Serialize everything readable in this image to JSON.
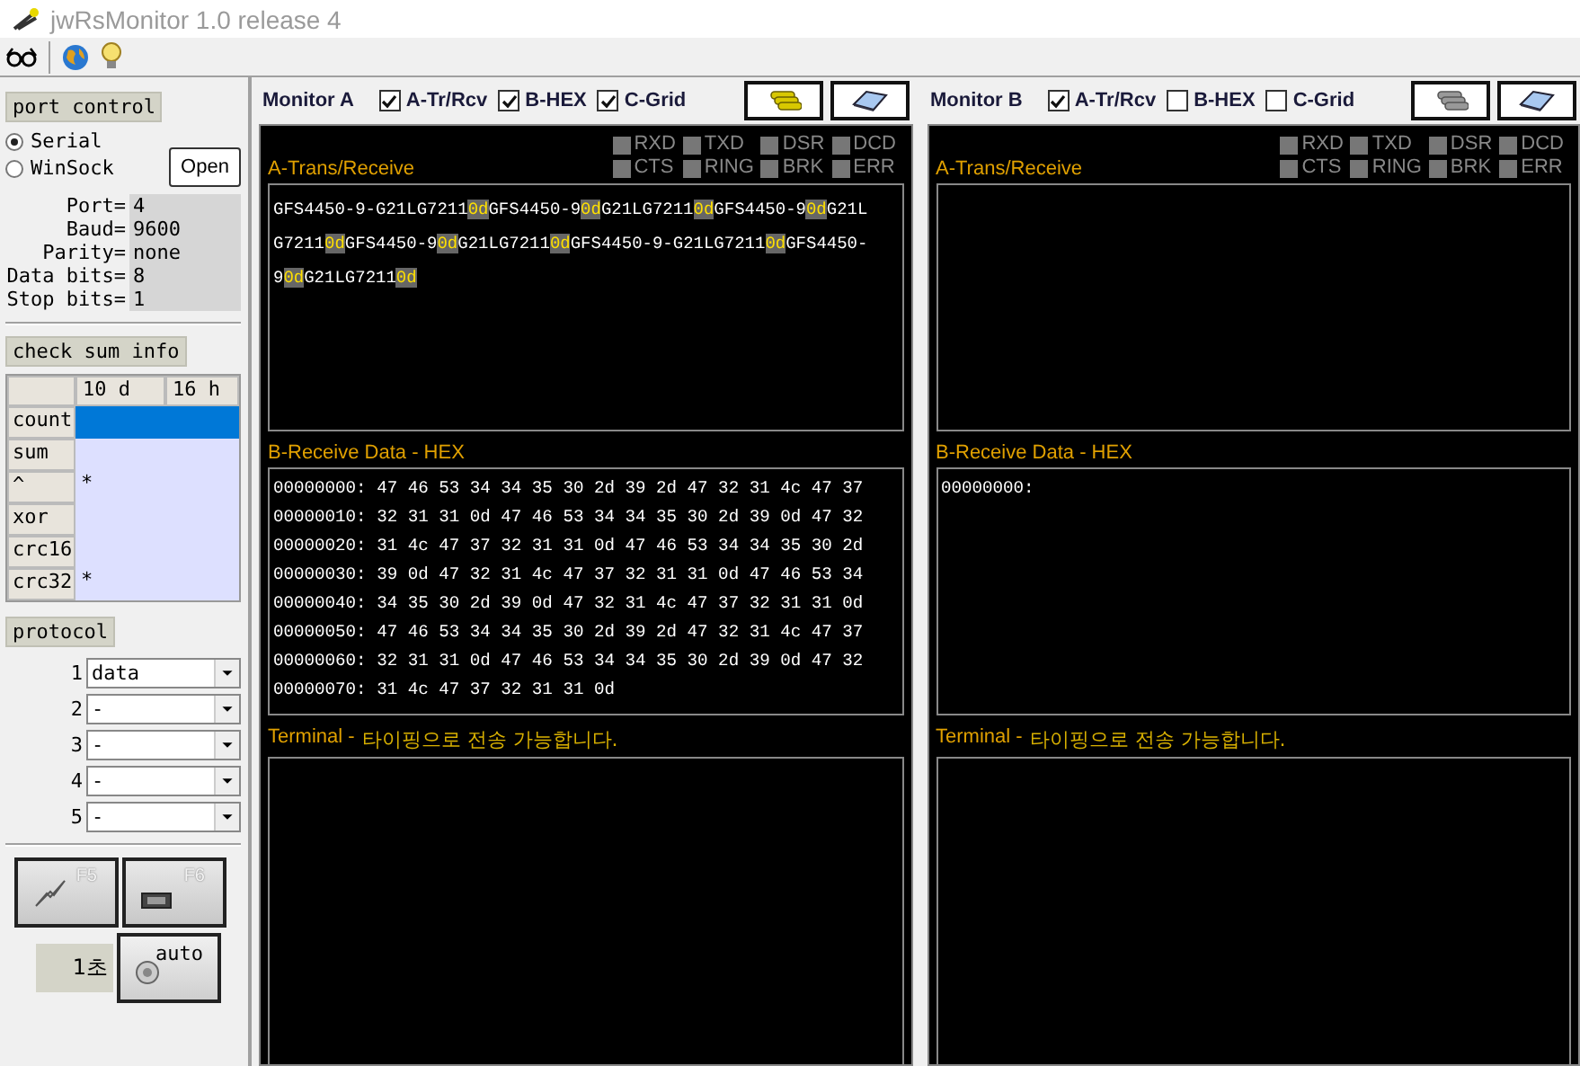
{
  "window": {
    "title": "jwRsMonitor 1.0 release 4"
  },
  "port_control": {
    "title": "port control",
    "modes": [
      {
        "label": "Serial",
        "selected": true
      },
      {
        "label": "WinSock",
        "selected": false
      }
    ],
    "open_button": "Open",
    "settings": [
      {
        "label": "Port=",
        "value": "4"
      },
      {
        "label": "Baud=",
        "value": "9600"
      },
      {
        "label": "Parity=",
        "value": "none"
      },
      {
        "label": "Data bits=",
        "value": "8"
      },
      {
        "label": "Stop bits=",
        "value": "1"
      }
    ]
  },
  "checksum": {
    "title": "check sum info",
    "columns": [
      "10 d",
      "16 h"
    ],
    "rows": [
      {
        "label": "count",
        "selected": true
      },
      {
        "label": "sum",
        "selected": false
      },
      {
        "label": "^",
        "selected": false,
        "dec": "*"
      },
      {
        "label": "xor",
        "selected": false
      },
      {
        "label": "crc16",
        "selected": false
      },
      {
        "label": "crc32",
        "selected": false,
        "dec": "*"
      }
    ]
  },
  "protocol": {
    "title": "protocol",
    "items": [
      {
        "number": "1",
        "value": "data"
      },
      {
        "number": "2",
        "value": "-"
      },
      {
        "number": "3",
        "value": "-"
      },
      {
        "number": "4",
        "value": "-"
      },
      {
        "number": "5",
        "value": "-"
      }
    ]
  },
  "actions": {
    "f5": "F5",
    "f6": "F6",
    "interval": "1초",
    "auto": "auto"
  },
  "monitors": [
    {
      "title": "Monitor A",
      "options": [
        {
          "label": "A-Tr/Rcv",
          "checked": true
        },
        {
          "label": "B-HEX",
          "checked": true
        },
        {
          "label": "C-Grid",
          "checked": true
        }
      ],
      "connect_active": true,
      "signals": [
        {
          "label": "RXD",
          "on": false
        },
        {
          "label": "TXD",
          "on": false
        },
        {
          "label": "DSR",
          "on": false
        },
        {
          "label": "DCD",
          "on": false
        },
        {
          "label": "CTS",
          "on": false
        },
        {
          "label": "RING",
          "on": false
        },
        {
          "label": "BRK",
          "on": false
        },
        {
          "label": "ERR",
          "on": false
        }
      ],
      "trans_label": "A-Trans/Receive",
      "trans_lines": [
        [
          {
            "kind": "plain",
            "text": "GFS4450-9-G21LG7211"
          },
          {
            "kind": "marker",
            "text": "0d"
          },
          {
            "kind": "plain",
            "text": "GFS4450-9"
          },
          {
            "kind": "marker",
            "text": "0d"
          },
          {
            "kind": "plain",
            "text": "G21LG7211"
          },
          {
            "kind": "marker",
            "text": "0d"
          },
          {
            "kind": "plain",
            "text": "GFS4450-9"
          },
          {
            "kind": "marker",
            "text": "0d"
          },
          {
            "kind": "plain",
            "text": "G21L"
          }
        ],
        [
          {
            "kind": "plain",
            "text": "G7211"
          },
          {
            "kind": "marker",
            "text": "0d"
          },
          {
            "kind": "plain",
            "text": "GFS4450-9"
          },
          {
            "kind": "marker",
            "text": "0d"
          },
          {
            "kind": "plain",
            "text": "G21LG7211"
          },
          {
            "kind": "marker",
            "text": "0d"
          },
          {
            "kind": "plain",
            "text": "GFS4450-9-G21LG7211"
          },
          {
            "kind": "marker",
            "text": "0d"
          },
          {
            "kind": "plain",
            "text": "GFS4450-"
          }
        ],
        [
          {
            "kind": "plain",
            "text": "9"
          },
          {
            "kind": "marker",
            "text": "0d"
          },
          {
            "kind": "plain",
            "text": "G21LG7211"
          },
          {
            "kind": "marker",
            "text": "0d"
          }
        ]
      ],
      "hex_label": "B-Receive Data - HEX",
      "hex_lines": [
        "00000000: 47 46 53 34 34 35 30 2d 39 2d 47 32 31 4c 47 37",
        "00000010: 32 31 31 0d 47 46 53 34 34 35 30 2d 39 0d 47 32",
        "00000020: 31 4c 47 37 32 31 31 0d 47 46 53 34 34 35 30 2d",
        "00000030: 39 0d 47 32 31 4c 47 37 32 31 31 0d 47 46 53 34",
        "00000040: 34 35 30 2d 39 0d 47 32 31 4c 47 37 32 31 31 0d",
        "00000050: 47 46 53 34 34 35 30 2d 39 2d 47 32 31 4c 47 37",
        "00000060: 32 31 31 0d 47 46 53 34 34 35 30 2d 39 0d 47 32",
        "00000070: 31 4c 47 37 32 31 31 0d"
      ],
      "terminal_label": "Terminal -",
      "terminal_hint": "타이핑으로 전송 가능합니다."
    },
    {
      "title": "Monitor B",
      "options": [
        {
          "label": "A-Tr/Rcv",
          "checked": true
        },
        {
          "label": "B-HEX",
          "checked": false
        },
        {
          "label": "C-Grid",
          "checked": false
        }
      ],
      "connect_active": false,
      "signals": [
        {
          "label": "RXD",
          "on": false
        },
        {
          "label": "TXD",
          "on": false
        },
        {
          "label": "DSR",
          "on": false
        },
        {
          "label": "DCD",
          "on": false
        },
        {
          "label": "CTS",
          "on": false
        },
        {
          "label": "RING",
          "on": false
        },
        {
          "label": "BRK",
          "on": false
        },
        {
          "label": "ERR",
          "on": false
        }
      ],
      "trans_label": "A-Trans/Receive",
      "hex_label": "B-Receive Data - HEX",
      "hex_lines": [
        "00000000:"
      ],
      "terminal_label": "Terminal -",
      "terminal_hint": "타이핑으로 전송 가능합니다."
    }
  ]
}
